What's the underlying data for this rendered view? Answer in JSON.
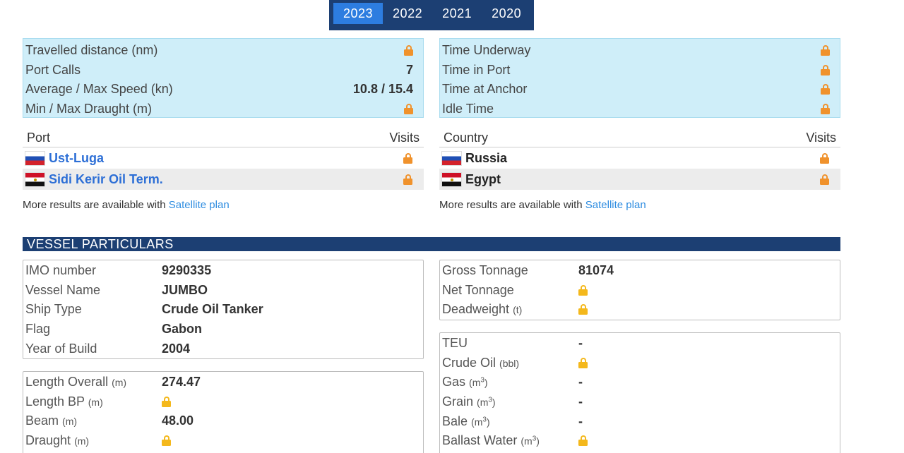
{
  "years": [
    "2023",
    "2022",
    "2021",
    "2020"
  ],
  "stats_left": [
    {
      "label": "Travelled distance (nm)",
      "value": null
    },
    {
      "label": "Port Calls",
      "value": "7"
    },
    {
      "label": "Average / Max Speed (kn)",
      "value": "10.8 / 15.4"
    },
    {
      "label": "Min / Max Draught (m)",
      "value": null
    }
  ],
  "stats_right": [
    {
      "label": "Time Underway"
    },
    {
      "label": "Time in Port"
    },
    {
      "label": "Time at Anchor"
    },
    {
      "label": "Idle Time"
    }
  ],
  "ports": {
    "col1": "Port",
    "col2": "Visits",
    "rows": [
      {
        "name": "Ust-Luga",
        "flag": "russia-flag"
      },
      {
        "name": "Sidi Kerir Oil Term.",
        "flag": "egypt-flag"
      }
    ]
  },
  "countries": {
    "col1": "Country",
    "col2": "Visits",
    "rows": [
      {
        "name": "Russia",
        "flag": "russia-flag"
      },
      {
        "name": "Egypt",
        "flag": "egypt-flag"
      }
    ]
  },
  "more": {
    "text": "More results are available with",
    "link": "Satellite plan"
  },
  "particulars_title": "VESSEL PARTICULARS",
  "identity": [
    {
      "label": "IMO number",
      "value": "9290335"
    },
    {
      "label": "Vessel Name",
      "value": "JUMBO"
    },
    {
      "label": "Ship Type",
      "value": "Crude Oil Tanker"
    },
    {
      "label": "Flag",
      "value": "Gabon"
    },
    {
      "label": "Year of Build",
      "value": "2004"
    }
  ],
  "dimensions": [
    {
      "label": "Length Overall",
      "unit": "(m)",
      "value": "274.47"
    },
    {
      "label": "Length BP",
      "unit": "(m)",
      "value": null
    },
    {
      "label": "Beam",
      "unit": "(m)",
      "value": "48.00"
    },
    {
      "label": "Draught",
      "unit": "(m)",
      "value": null
    }
  ],
  "tonnage": [
    {
      "label": "Gross Tonnage",
      "unit": "",
      "value": "81074"
    },
    {
      "label": "Net Tonnage",
      "unit": "",
      "value": null
    },
    {
      "label": "Deadweight",
      "unit": "(t)",
      "value": null
    }
  ],
  "capacity": [
    {
      "label": "TEU",
      "unit": "",
      "value": "-"
    },
    {
      "label": "Crude Oil",
      "unit": "(bbl)",
      "value": null
    },
    {
      "label": "Gas",
      "unit": "m3",
      "value": "-"
    },
    {
      "label": "Grain",
      "unit": "m3",
      "value": "-"
    },
    {
      "label": "Bale",
      "unit": "m3",
      "value": "-"
    },
    {
      "label": "Ballast Water",
      "unit": "m3",
      "value": null
    }
  ],
  "colors": {
    "navy": "#1c3f73",
    "tab_active": "#2d7de0",
    "stat_bg": "#cfeef9",
    "link": "#2d6fd6",
    "lock_orange": "#f0922c",
    "lock_yellow": "#f4b81c"
  }
}
